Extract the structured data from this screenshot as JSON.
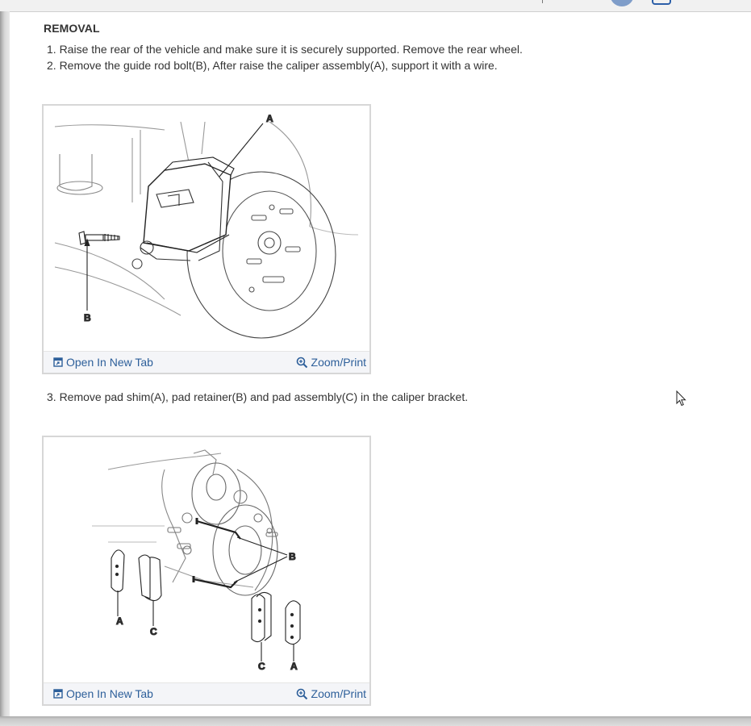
{
  "section": {
    "title": "REMOVAL"
  },
  "steps": [
    "1. Raise the rear of the vehicle and make sure it is securely supported. Remove the rear wheel.",
    "2. Remove the guide rod bolt(B), After raise the caliper assembly(A), support it with a wire.",
    "3. Remove pad shim(A), pad retainer(B) and pad assembly(C) in the caliper bracket."
  ],
  "figures": [
    {
      "callouts": {
        "a": "A",
        "b": "B"
      },
      "open_label": "Open In New Tab",
      "zoom_label": "Zoom/Print"
    },
    {
      "callouts": {
        "a1": "A",
        "c1": "C",
        "b": "B",
        "c2": "C",
        "a2": "A"
      },
      "open_label": "Open In New Tab",
      "zoom_label": "Zoom/Print"
    }
  ],
  "icons": {
    "open": "open-in-new-tab-icon",
    "zoom": "magnifier-zoom-icon",
    "cursor": "mouse-pointer-icon"
  },
  "colors": {
    "link": "#2d5f9a",
    "text": "#333333",
    "frame": "#d7d7d7",
    "caption_bar": "#f4f5f8"
  }
}
